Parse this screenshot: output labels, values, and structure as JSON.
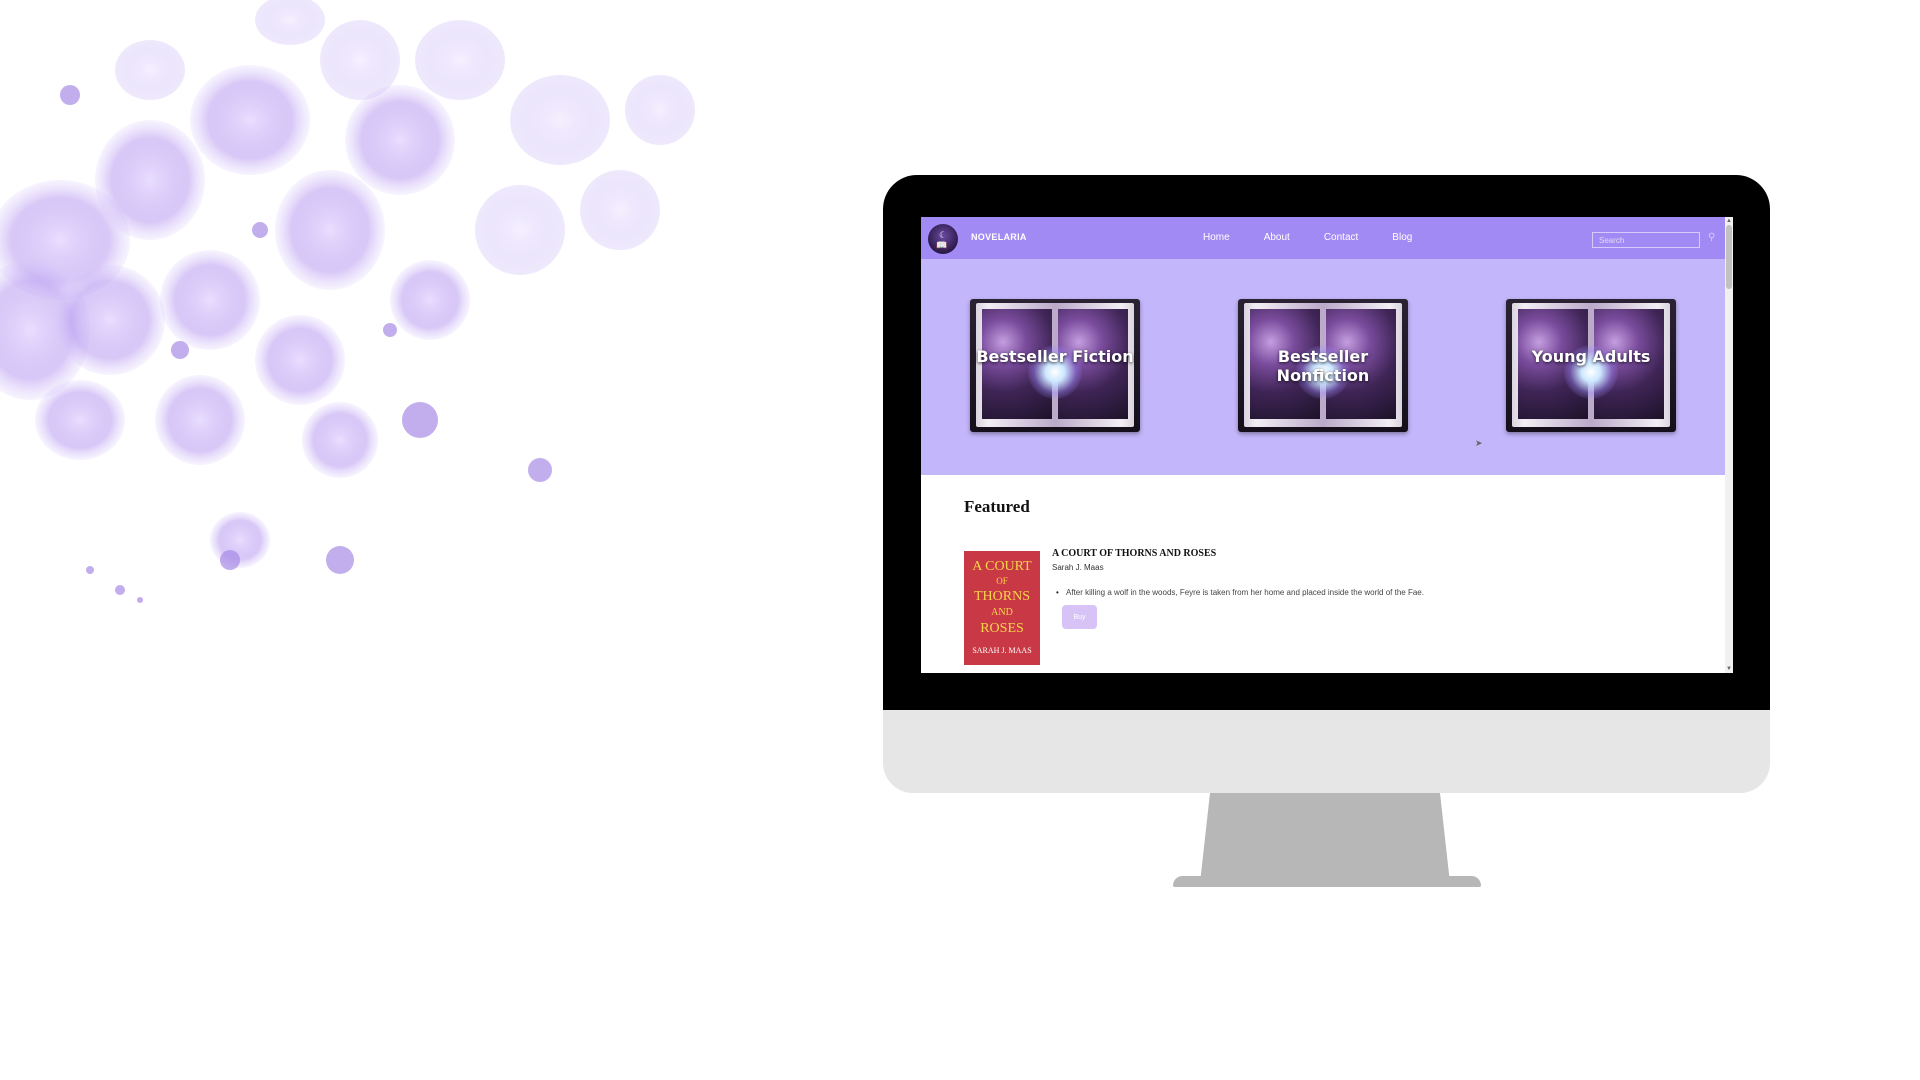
{
  "navbar": {
    "brand": "NOVELARIA",
    "links": [
      "Home",
      "About",
      "Contact",
      "Blog"
    ],
    "search_placeholder": "Search"
  },
  "hero": {
    "cards": [
      {
        "label": "Bestseller Fiction"
      },
      {
        "label": "Bestseller Nonfiction"
      },
      {
        "label": "Young Adults"
      }
    ]
  },
  "featured": {
    "heading": "Featured",
    "book": {
      "title": "A COURT OF THORNS AND ROSES",
      "author": "Sarah J. Maas",
      "description": "After killing a wolf in the woods, Feyre is taken from her home and placed inside the world of the Fae.",
      "buy_label": "Buy",
      "cover_lines": [
        "A COURT",
        "OF",
        "THORNS",
        "AND",
        "ROSES",
        "SARAH J. MAAS"
      ]
    }
  },
  "colors": {
    "nav": "#a18af3",
    "hero": "#c3b6fa",
    "buy": "#d7c3f6",
    "cover": "#c93845"
  },
  "icons": [
    "logo-emblem-icon",
    "search-icon",
    "cursor-icon"
  ]
}
